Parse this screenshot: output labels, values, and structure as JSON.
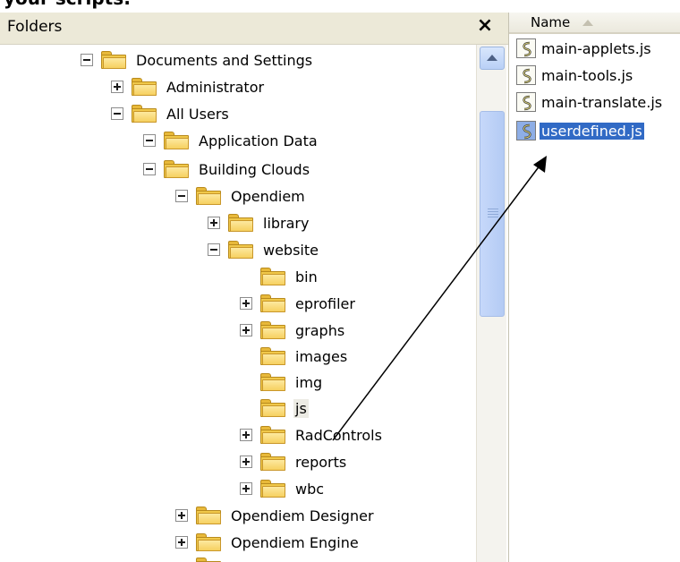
{
  "top_text": "your scripts:",
  "folders_pane": {
    "title": "Folders",
    "close_glyph": "×",
    "tree": [
      {
        "label": "Documents and Settings",
        "toggle": "minus"
      },
      {
        "label": "Administrator",
        "toggle": "plus"
      },
      {
        "label": "All Users",
        "toggle": "minus"
      },
      {
        "label": "Application Data",
        "toggle": "minus"
      },
      {
        "label": "Building Clouds",
        "toggle": "minus"
      },
      {
        "label": "Opendiem",
        "toggle": "minus"
      },
      {
        "label": "library",
        "toggle": "plus"
      },
      {
        "label": "website",
        "toggle": "minus"
      },
      {
        "label": "bin",
        "toggle": "none"
      },
      {
        "label": "eprofiler",
        "toggle": "plus"
      },
      {
        "label": "graphs",
        "toggle": "plus"
      },
      {
        "label": "images",
        "toggle": "none"
      },
      {
        "label": "img",
        "toggle": "none"
      },
      {
        "label": "js",
        "toggle": "none",
        "selected": true
      },
      {
        "label": "RadControls",
        "toggle": "plus"
      },
      {
        "label": "reports",
        "toggle": "plus"
      },
      {
        "label": "wbc",
        "toggle": "plus"
      },
      {
        "label": "Opendiem Designer",
        "toggle": "plus"
      },
      {
        "label": "Opendiem Engine",
        "toggle": "plus"
      }
    ]
  },
  "files_pane": {
    "column_header": "Name",
    "files": [
      {
        "name": "main-applets.js",
        "selected": false
      },
      {
        "name": "main-tools.js",
        "selected": false
      },
      {
        "name": "main-translate.js",
        "selected": false
      },
      {
        "name": "userdefined.js",
        "selected": true
      }
    ]
  },
  "colors": {
    "selection": "#316ac5",
    "folder": "#f0c84a",
    "header_bg": "#ece9d8",
    "scrollbar": "#b9d0f6"
  }
}
